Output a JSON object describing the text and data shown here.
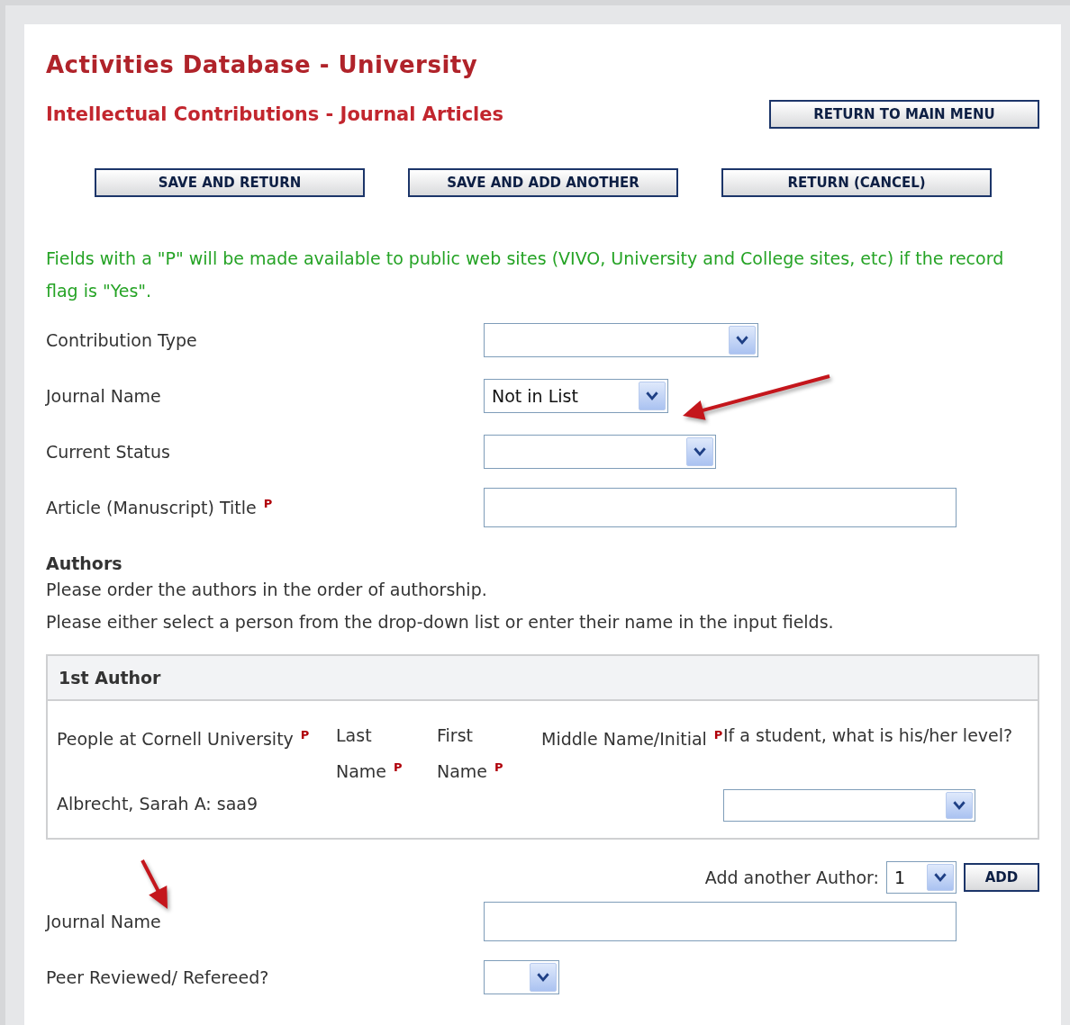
{
  "header": {
    "title": "Activities Database - University",
    "subtitle": "Intellectual Contributions - Journal Articles",
    "main_menu_button": "RETURN TO MAIN MENU"
  },
  "actions": [
    "SAVE AND RETURN",
    "SAVE AND ADD ANOTHER",
    "RETURN (CANCEL)"
  ],
  "notice": "Fields with a \"P\" will be made available to public web sites (VIVO, University and College sites, etc) if the record flag is \"Yes\".",
  "fields": [
    {
      "kind": "select",
      "label": "Contribution Type"
    },
    {
      "kind": "select",
      "label": "Journal Name",
      "value": "Not in List"
    },
    {
      "kind": "select",
      "label": "Current Status"
    },
    {
      "kind": "text",
      "label": "Article (Manuscript) Title",
      "marker": "P"
    }
  ],
  "authors": {
    "heading": "Authors",
    "instructions": [
      "Please order the authors in the order of authorship.",
      "Please either select a person from the drop-down list or enter their name in the input fields."
    ],
    "panel": {
      "title": "1st Author",
      "columns": [
        {
          "label": "People at Cornell University",
          "marker": "P"
        },
        {
          "label": "Last Name",
          "marker": "P"
        },
        {
          "label": "First Name",
          "marker": "P"
        },
        {
          "label": "Middle Name/Initial",
          "marker": "P"
        },
        {
          "label": "If a student, what is his/her level?"
        }
      ],
      "person": "Albrecht, Sarah A: saa9"
    },
    "add_another": {
      "label": "Add another Author:",
      "value": "1",
      "button": "ADD"
    }
  },
  "more_fields": [
    {
      "kind": "text",
      "label": "Journal Name"
    },
    {
      "kind": "select",
      "label": "Peer Reviewed/ Refereed?"
    }
  ]
}
